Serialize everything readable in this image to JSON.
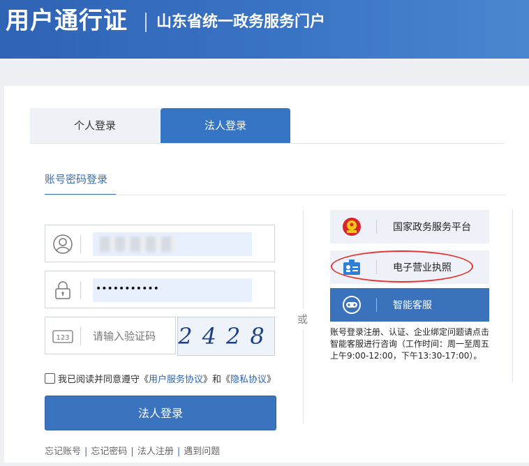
{
  "header": {
    "title": "用户通行证",
    "subtitle": "山东省统一政务服务门户"
  },
  "tabs": {
    "personal": "个人登录",
    "legal": "法人登录"
  },
  "login_method": "账号密码登录",
  "form": {
    "password_mask": "•••••••••••",
    "captcha_placeholder": "请输入验证码",
    "captcha_code": "2428",
    "captcha_icon_text": "123",
    "agree_prefix": "我已阅读并同意遵守《",
    "agree_service": "用户服务协议",
    "agree_mid": "》和《",
    "agree_privacy": "隐私协议",
    "agree_suffix": "》",
    "submit": "法人登录"
  },
  "bottom_links": [
    "忘记账号",
    "忘记密码",
    "法人注册",
    "遇到问题"
  ],
  "or_label": "或",
  "options": [
    {
      "label": "国家政务服务平台",
      "icon": "emblem-icon"
    },
    {
      "label": "电子营业执照",
      "icon": "license-icon"
    },
    {
      "label": "智能客服",
      "icon": "robot-icon"
    }
  ],
  "help_text": "账号登录注册、认证、企业绑定问题请点击智能客服进行咨询（工作时间：周一至周五上午9:00-12:00，下午13:30-17:00）。",
  "colors": {
    "brand": "#3a73be",
    "highlight": "#e3342f"
  }
}
